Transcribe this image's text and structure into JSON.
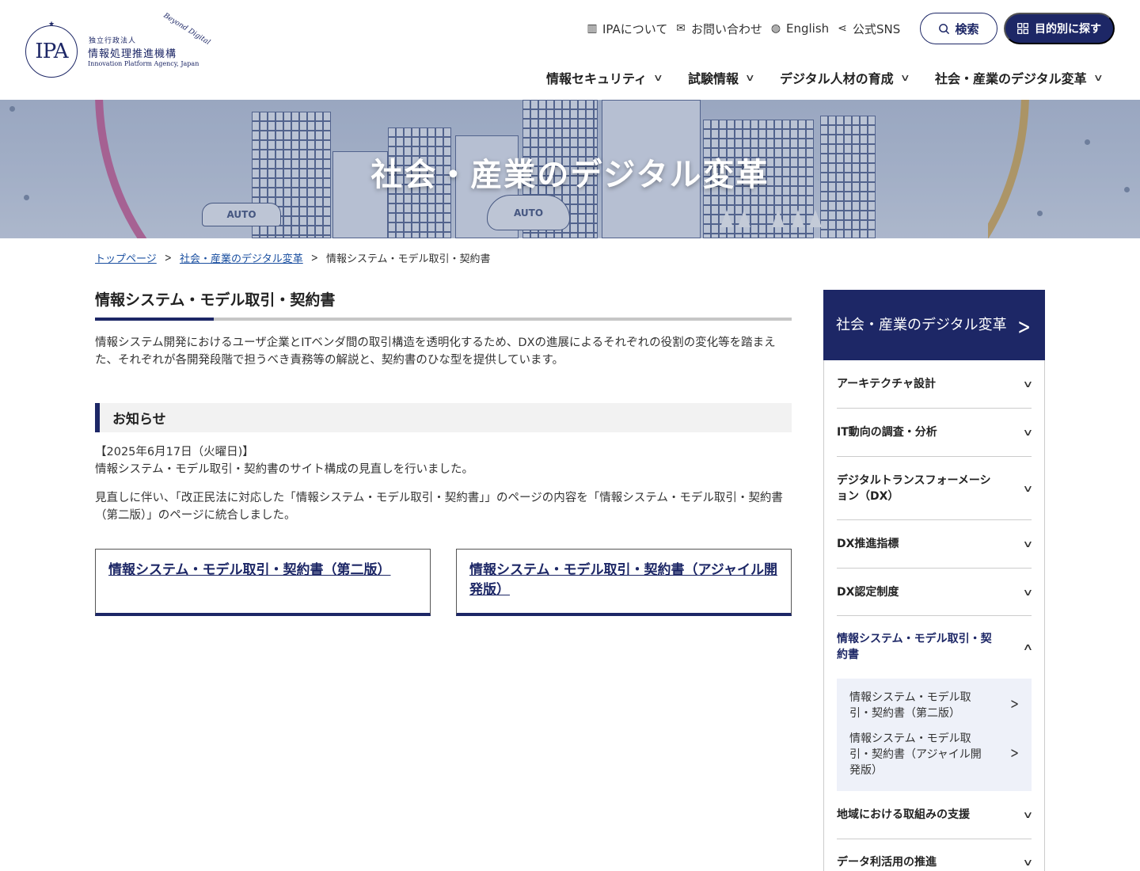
{
  "header": {
    "logo": {
      "org_small": "独立行政法人",
      "org_main": "情報処理推進機構",
      "org_en": "Innovation Platform Agency, Japan",
      "mark": "IPA",
      "tagline": "Beyond Digital"
    },
    "utility_links": [
      {
        "label": "IPAについて",
        "icon": "building-icon"
      },
      {
        "label": "お問い合わせ",
        "icon": "mail-icon"
      },
      {
        "label": "English",
        "icon": "globe-icon"
      },
      {
        "label": "公式SNS",
        "icon": "share-icon"
      }
    ],
    "search_button": "検索",
    "purpose_button": "目的別に探す",
    "global_nav": [
      {
        "label": "情報セキュリティ"
      },
      {
        "label": "試験情報"
      },
      {
        "label": "デジタル人材の育成"
      },
      {
        "label": "社会・産業のデジタル変革"
      }
    ]
  },
  "hero": {
    "title": "社会・産業のデジタル変革",
    "car_label": "AUTO"
  },
  "breadcrumb": {
    "items": [
      "トップページ",
      "社会・産業のデジタル変革"
    ],
    "current": "情報システム・モデル取引・契約書"
  },
  "main": {
    "title": "情報システム・モデル取引・契約書",
    "intro": "情報システム開発におけるユーザ企業とITベンダ間の取引構造を透明化するため、DXの進展によるそれぞれの役割の変化等を踏まえた、それぞれが各開発段階で担うべき責務等の解説と、契約書のひな型を提供しています。",
    "notice": {
      "heading": "お知らせ",
      "date": "【2025年6月17日（火曜日)】",
      "line1": "情報システム・モデル取引・契約書のサイト構成の見直しを行いました。",
      "para2": "見直しに伴い、「改正民法に対応した「情報システム・モデル取引・契約書」」のページの内容を「情報システム・モデル取引・契約書（第二版）」のページに統合しました。"
    },
    "cards": [
      {
        "label": "情報システム・モデル取引・契約書（第二版）"
      },
      {
        "label": "情報システム・モデル取引・契約書（アジャイル開発版）"
      }
    ]
  },
  "sidebar": {
    "heading": "社会・産業のデジタル変革",
    "items": [
      {
        "label": "アーキテクチャ設計"
      },
      {
        "label": "IT動向の調査・分析"
      },
      {
        "label": "デジタルトランスフォーメーション（DX）"
      },
      {
        "label": "DX推進指標"
      },
      {
        "label": "DX認定制度"
      },
      {
        "label": "情報システム・モデル取引・契約書"
      },
      {
        "label": "地域における取組みの支援"
      },
      {
        "label": "データ利活用の推進"
      }
    ],
    "sub_items": [
      {
        "label": "情報システム・モデル取引・契約書（第二版）"
      },
      {
        "label": "情報システム・モデル取引・契約書（アジャイル開発版）"
      }
    ]
  },
  "colors": {
    "brand_navy": "#1d2766",
    "link_blue": "#1a4fa0",
    "notice_bg": "#f2f2f2",
    "sub_menu_bg": "#eef1f9"
  }
}
